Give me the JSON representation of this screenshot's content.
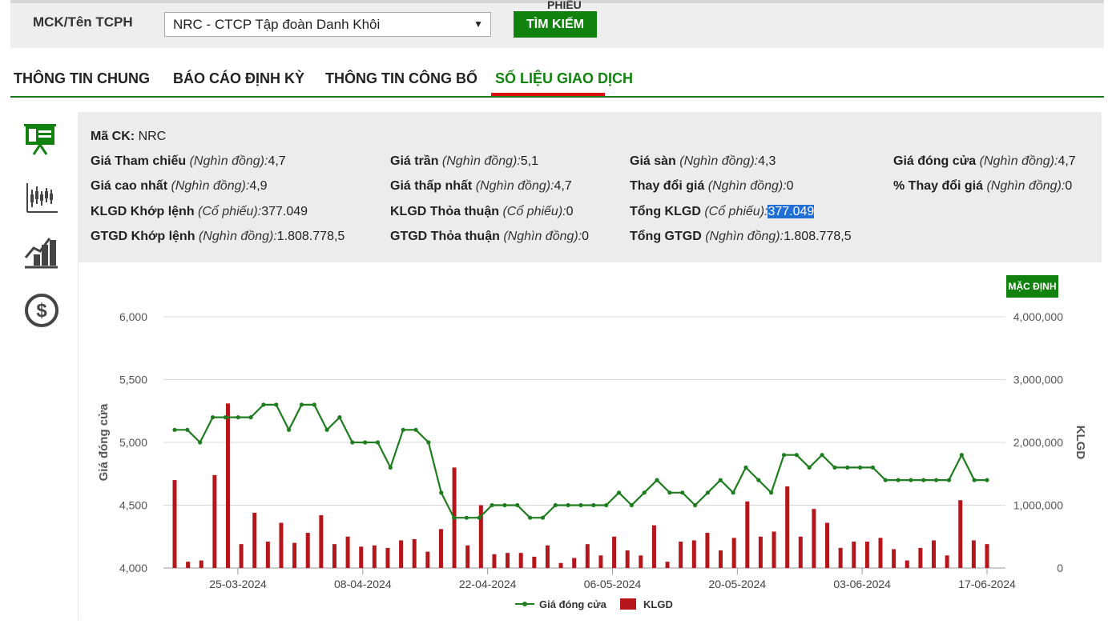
{
  "search": {
    "label": "MCK/Tên TCPH",
    "selected": "NRC - CTCP Tập đoàn Danh Khôi",
    "button": "TÌM KIẾM",
    "button_overflow": "PHIẾU"
  },
  "tabs": [
    {
      "label": "THÔNG TIN CHUNG",
      "active": false
    },
    {
      "label": "BÁO CÁO ĐỊNH KỲ",
      "active": false
    },
    {
      "label": "THÔNG TIN CÔNG BỐ",
      "active": false
    },
    {
      "label": "SỐ LIỆU GIAO DỊCH",
      "active": true
    }
  ],
  "sidebar_icons": [
    "presentation-board-icon",
    "candlestick-chart-icon",
    "growth-chart-icon",
    "dollar-coin-icon"
  ],
  "info": {
    "ma_ck": {
      "label": "Mã CK:",
      "value": "NRC"
    },
    "rows": [
      [
        {
          "label": "Giá Tham chiếu",
          "unit": "(Nghìn đồng):",
          "value": "4,7"
        },
        {
          "label": "Giá trần",
          "unit": "(Nghìn đồng):",
          "value": "5,1"
        },
        {
          "label": "Giá sàn",
          "unit": "(Nghìn đồng):",
          "value": "4,3"
        },
        {
          "label": "Giá đóng cửa",
          "unit": "(Nghìn đồng):",
          "value": "4,7"
        }
      ],
      [
        {
          "label": "Giá cao nhất",
          "unit": "(Nghìn đồng):",
          "value": "4,9"
        },
        {
          "label": "Giá thấp nhất",
          "unit": "(Nghìn đồng):",
          "value": "4,7"
        },
        {
          "label": "Thay đổi giá",
          "unit": "(Nghìn đồng):",
          "value": "0"
        },
        {
          "label": "% Thay đổi giá",
          "unit": "(Nghìn đồng):",
          "value": "0"
        }
      ],
      [
        {
          "label": "KLGD Khớp lệnh",
          "unit": "(Cổ phiếu):",
          "value": "377.049"
        },
        {
          "label": "KLGD Thỏa thuận",
          "unit": "(Cổ phiếu):",
          "value": "0"
        },
        {
          "label": "Tổng KLGD",
          "unit": "(Cổ phiếu):",
          "value": "377.049",
          "highlight": true
        }
      ],
      [
        {
          "label": "GTGD Khớp lệnh",
          "unit": "(Nghìn đồng):",
          "value": "1.808.778,5"
        },
        {
          "label": "GTGD Thỏa thuận",
          "unit": "(Nghìn đồng):",
          "value": "0"
        },
        {
          "label": "Tổng GTGD",
          "unit": "(Nghìn đồng):",
          "value": "1.808.778,5"
        }
      ]
    ]
  },
  "default_button": "MẶC ĐỊNH",
  "colors": {
    "brand_green": "#12820f",
    "price_line": "#1e7d1e",
    "volume_bar": "#b5161b",
    "tab_underline": "#dd1111"
  },
  "chart_data": {
    "type": "bar+line",
    "ylabel": "Giá đóng cửa",
    "y2label": "KLGD",
    "ylim": [
      4000,
      6000
    ],
    "y2lim": [
      0,
      4000000
    ],
    "yticks": [
      "4,000",
      "4,500",
      "5,000",
      "5,500",
      "6,000"
    ],
    "y2ticks": [
      "0",
      "1,000,000",
      "2,000,000",
      "3,000,000",
      "4,000,000"
    ],
    "xticks": [
      "25-03-2024",
      "08-04-2024",
      "22-04-2024",
      "06-05-2024",
      "20-05-2024",
      "03-06-2024",
      "17-06-2024"
    ],
    "grid": true,
    "legend_position": "bottom",
    "series": [
      {
        "name": "Giá đóng cửa",
        "type": "line",
        "values": [
          5100,
          5100,
          5000,
          5200,
          5200,
          5200,
          5200,
          5300,
          5300,
          5100,
          5300,
          5300,
          5100,
          5200,
          5000,
          5000,
          5000,
          4800,
          5100,
          5100,
          5000,
          4600,
          4400,
          4400,
          4400,
          4500,
          4500,
          4500,
          4400,
          4400,
          4500,
          4500,
          4500,
          4500,
          4500,
          4600,
          4500,
          4600,
          4700,
          4600,
          4600,
          4500,
          4600,
          4700,
          4600,
          4800,
          4700,
          4600,
          4900,
          4900,
          4800,
          4900,
          4800,
          4800,
          4800,
          4800,
          4700,
          4700,
          4700,
          4700,
          4700,
          4700,
          4900,
          4700,
          4700
        ]
      },
      {
        "name": "KLGD",
        "type": "bar",
        "values": [
          1400000,
          100000,
          120000,
          1480000,
          2620000,
          380000,
          880000,
          420000,
          720000,
          400000,
          560000,
          840000,
          380000,
          500000,
          340000,
          360000,
          320000,
          440000,
          460000,
          260000,
          620000,
          1600000,
          360000,
          1000000,
          220000,
          240000,
          240000,
          180000,
          360000,
          80000,
          160000,
          380000,
          200000,
          500000,
          280000,
          200000,
          680000,
          100000,
          420000,
          440000,
          560000,
          280000,
          480000,
          1060000,
          500000,
          580000,
          1300000,
          500000,
          940000,
          720000,
          320000,
          420000,
          420000,
          480000,
          300000,
          120000,
          320000,
          440000,
          200000,
          1080000,
          440000,
          380000
        ]
      }
    ]
  }
}
